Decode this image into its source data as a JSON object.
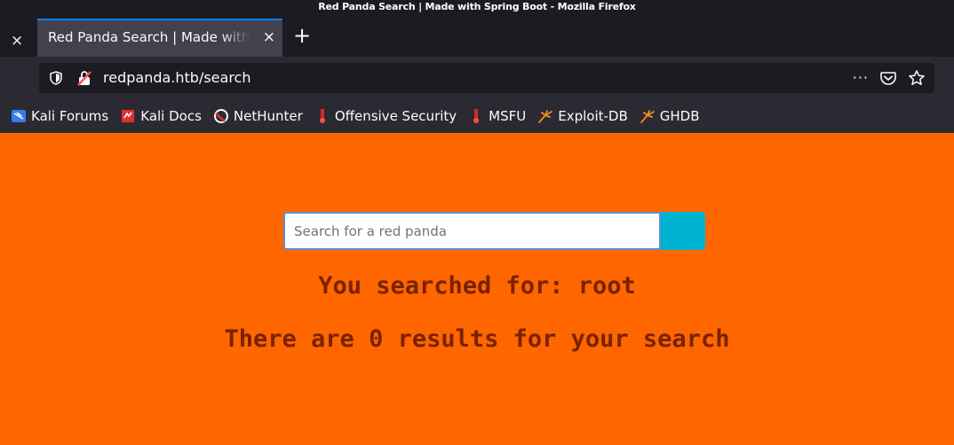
{
  "window": {
    "title": "Red Panda Search | Made with Spring Boot - Mozilla Firefox"
  },
  "tabs": {
    "previous_close": "×",
    "active_title": "Red Panda Search | Made with Spring Boot",
    "active_close": "×",
    "new_tab": "+"
  },
  "navbar": {
    "url": "redpanda.htb/search",
    "menu_dots": "···"
  },
  "bookmarks": [
    {
      "label": "Kali Forums",
      "icon": "kali-forums-icon"
    },
    {
      "label": "Kali Docs",
      "icon": "kali-docs-icon"
    },
    {
      "label": "NetHunter",
      "icon": "nethunter-icon"
    },
    {
      "label": "Offensive Security",
      "icon": "offsec-icon"
    },
    {
      "label": "MSFU",
      "icon": "msfu-icon"
    },
    {
      "label": "Exploit-DB",
      "icon": "exploit-db-icon"
    },
    {
      "label": "GHDB",
      "icon": "ghdb-icon"
    }
  ],
  "page": {
    "search_placeholder": "Search for a red panda",
    "search_value": "",
    "searched_for": "You searched for: root",
    "result_count": "There are 0 results for your search"
  },
  "colors": {
    "page_background": "#ff6600",
    "search_button": "#00b3d1",
    "result_text": "#7a2200",
    "tab_accent": "#0a84ff"
  }
}
